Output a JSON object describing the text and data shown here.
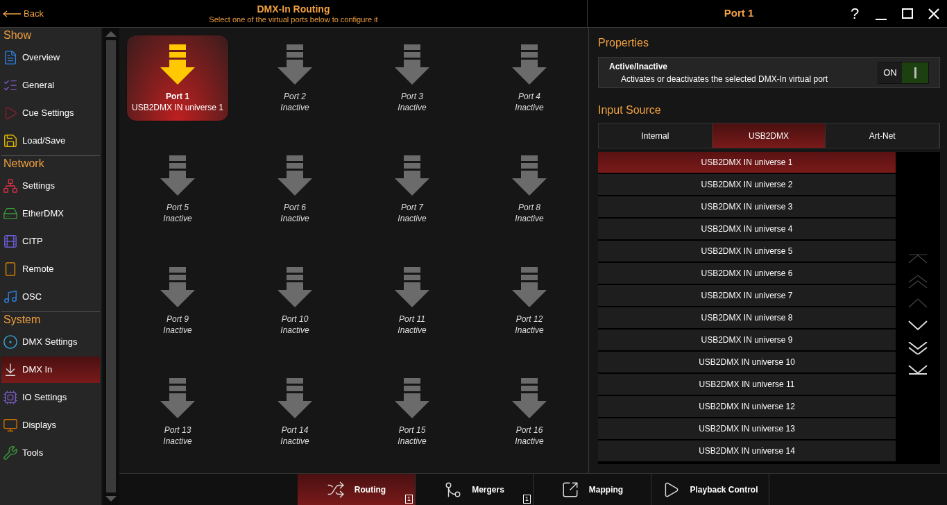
{
  "header": {
    "back": "Back",
    "title": "DMX-In Routing",
    "subtitle": "Select one of the virtual ports below to configure it"
  },
  "sidebar": [
    {
      "title": "Show",
      "items": [
        {
          "label": "Overview",
          "selected": false
        },
        {
          "label": "General",
          "selected": false
        },
        {
          "label": "Cue Settings",
          "selected": false
        },
        {
          "label": "Load/Save",
          "selected": false
        }
      ]
    },
    {
      "title": "Network",
      "items": [
        {
          "label": "Settings",
          "selected": false
        },
        {
          "label": "EtherDMX",
          "selected": false
        },
        {
          "label": "CITP",
          "selected": false
        },
        {
          "label": "Remote",
          "selected": false
        },
        {
          "label": "OSC",
          "selected": false
        }
      ]
    },
    {
      "title": "System",
      "items": [
        {
          "label": "DMX Settings",
          "selected": false
        },
        {
          "label": "DMX In",
          "selected": true
        },
        {
          "label": "IO Settings",
          "selected": false
        },
        {
          "label": "Displays",
          "selected": false
        },
        {
          "label": "Tools",
          "selected": false
        }
      ]
    }
  ],
  "ports": [
    {
      "name": "Port 1",
      "status": "USB2DMX IN universe 1",
      "selected": true
    },
    {
      "name": "Port 2",
      "status": "Inactive",
      "selected": false
    },
    {
      "name": "Port 3",
      "status": "Inactive",
      "selected": false
    },
    {
      "name": "Port 4",
      "status": "Inactive",
      "selected": false
    },
    {
      "name": "Port 5",
      "status": "Inactive",
      "selected": false
    },
    {
      "name": "Port 6",
      "status": "Inactive",
      "selected": false
    },
    {
      "name": "Port 7",
      "status": "Inactive",
      "selected": false
    },
    {
      "name": "Port 8",
      "status": "Inactive",
      "selected": false
    },
    {
      "name": "Port 9",
      "status": "Inactive",
      "selected": false
    },
    {
      "name": "Port 10",
      "status": "Inactive",
      "selected": false
    },
    {
      "name": "Port 11",
      "status": "Inactive",
      "selected": false
    },
    {
      "name": "Port 12",
      "status": "Inactive",
      "selected": false
    },
    {
      "name": "Port 13",
      "status": "Inactive",
      "selected": false
    },
    {
      "name": "Port 14",
      "status": "Inactive",
      "selected": false
    },
    {
      "name": "Port 15",
      "status": "Inactive",
      "selected": false
    },
    {
      "name": "Port 16",
      "status": "Inactive",
      "selected": false
    }
  ],
  "bottom_tabs": [
    {
      "label": "Routing",
      "badge": "1",
      "selected": true
    },
    {
      "label": "Mergers",
      "badge": "1",
      "selected": false
    },
    {
      "label": "Mapping",
      "selected": false
    },
    {
      "label": "Playback Control",
      "selected": false
    }
  ],
  "panel": {
    "title": "Port 1",
    "help": "?",
    "properties_heading": "Properties",
    "active": {
      "label": "Active/Inactive",
      "description": "Activates or deactivates the selected DMX-In virtual port",
      "state_text": "ON",
      "on": true
    },
    "input_heading": "Input Source",
    "source_tabs": [
      {
        "label": "Internal",
        "selected": false
      },
      {
        "label": "USB2DMX",
        "selected": true
      },
      {
        "label": "Art-Net",
        "selected": false
      }
    ],
    "universes": [
      {
        "label": "USB2DMX IN universe 1",
        "selected": true
      },
      {
        "label": "USB2DMX IN universe 2",
        "selected": false
      },
      {
        "label": "USB2DMX IN universe 3",
        "selected": false
      },
      {
        "label": "USB2DMX IN universe 4",
        "selected": false
      },
      {
        "label": "USB2DMX IN universe 5",
        "selected": false
      },
      {
        "label": "USB2DMX IN universe 6",
        "selected": false
      },
      {
        "label": "USB2DMX IN universe 7",
        "selected": false
      },
      {
        "label": "USB2DMX IN universe 8",
        "selected": false
      },
      {
        "label": "USB2DMX IN universe 9",
        "selected": false
      },
      {
        "label": "USB2DMX IN universe 10",
        "selected": false
      },
      {
        "label": "USB2DMX IN universe 11",
        "selected": false
      },
      {
        "label": "USB2DMX IN universe 12",
        "selected": false
      },
      {
        "label": "USB2DMX IN universe 13",
        "selected": false
      },
      {
        "label": "USB2DMX IN universe 14",
        "selected": false
      }
    ],
    "scroll_buttons": [
      {
        "kind": "top",
        "disabled": true
      },
      {
        "kind": "page-up",
        "disabled": true
      },
      {
        "kind": "up",
        "disabled": true
      },
      {
        "kind": "down",
        "disabled": false
      },
      {
        "kind": "page-down",
        "disabled": false
      },
      {
        "kind": "bottom",
        "disabled": false
      }
    ]
  }
}
